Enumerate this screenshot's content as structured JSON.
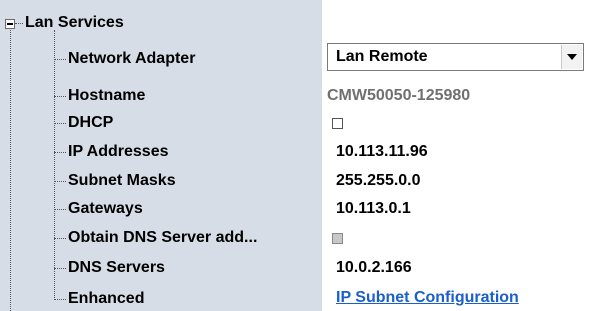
{
  "tree": {
    "root_label": "Lan Services",
    "rows": [
      {
        "label": "Network Adapter"
      },
      {
        "label": "Hostname"
      },
      {
        "label": "DHCP"
      },
      {
        "label": "IP Addresses"
      },
      {
        "label": "Subnet Masks"
      },
      {
        "label": "Gateways"
      },
      {
        "label": "Obtain DNS Server add..."
      },
      {
        "label": "DNS Servers"
      },
      {
        "label": "Enhanced"
      }
    ]
  },
  "values": {
    "network_adapter": "Lan Remote",
    "hostname": "CMW50050-125980",
    "dhcp_checked": false,
    "ip_addresses": "10.113.11.96",
    "subnet_masks": "255.255.0.0",
    "gateways": "10.113.0.1",
    "obtain_dns_checked": false,
    "dns_servers": "10.0.2.166",
    "enhanced_link": "IP Subnet Configuration"
  },
  "colors": {
    "left_pane_bg": "#d6dde6",
    "link": "#1a5fcc"
  }
}
